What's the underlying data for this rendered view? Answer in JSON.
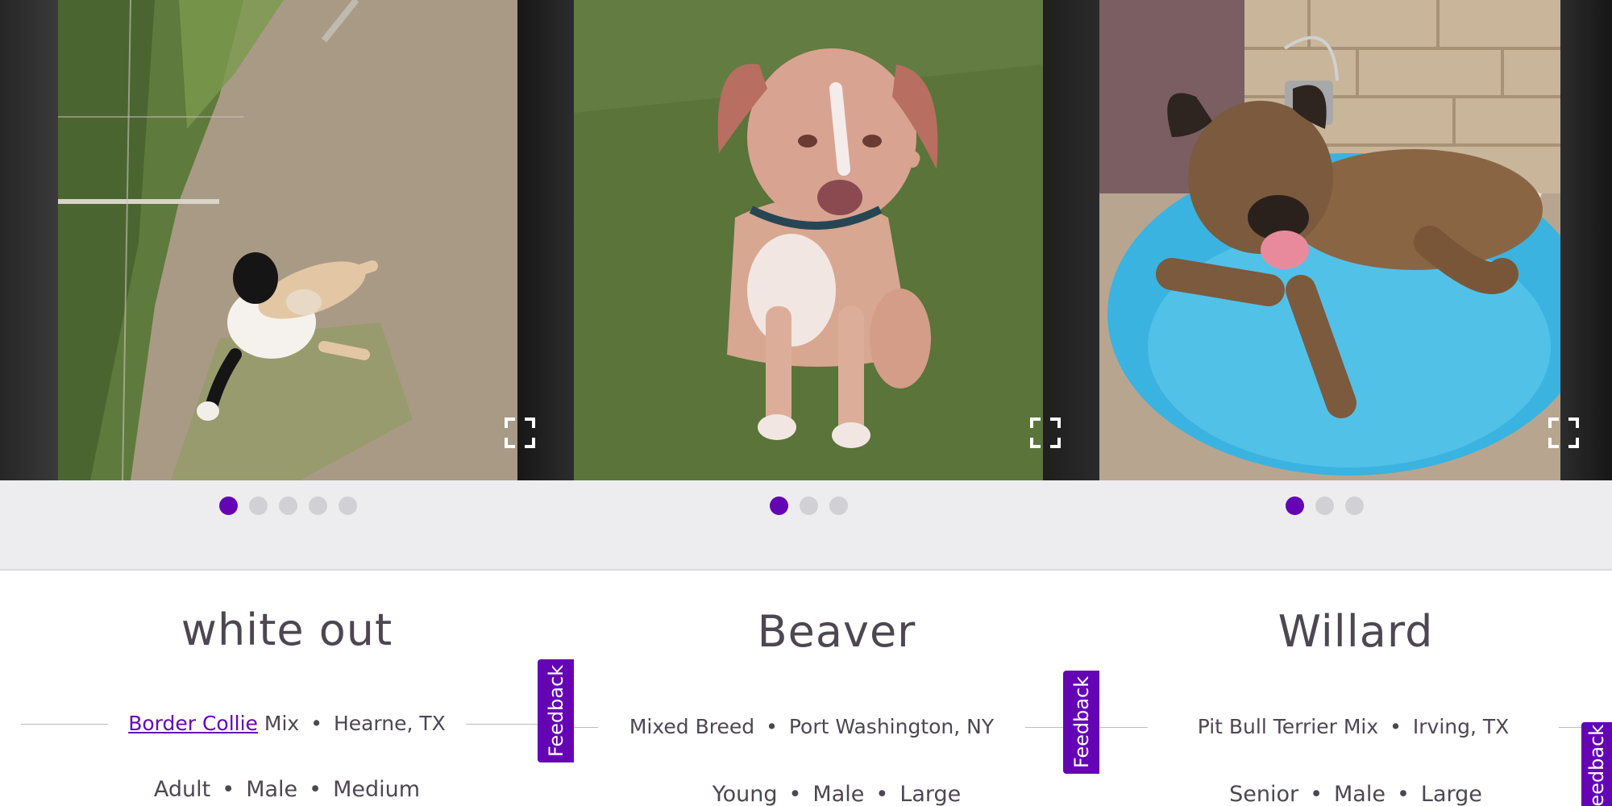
{
  "colors": {
    "accent": "#6504b5",
    "dot_inactive": "#d1d0d5",
    "text": "#4d4751",
    "dots_bar": "#ededef"
  },
  "icons": {
    "expand": "expand-fullscreen-icon"
  },
  "pets": [
    {
      "name": "white out",
      "breed_link": "Border Collie",
      "breed_suffix": "Mix",
      "location": "Hearne, TX",
      "age": "Adult",
      "gender": "Male",
      "size": "Medium",
      "photo_count": 5,
      "active_photo": 1,
      "feedback_label": "Feedback"
    },
    {
      "name": "Beaver",
      "breed": "Mixed Breed",
      "location": "Port Washington, NY",
      "age": "Young",
      "gender": "Male",
      "size": "Large",
      "photo_count": 3,
      "active_photo": 1,
      "feedback_label": "Feedback"
    },
    {
      "name": "Willard",
      "breed": "Pit Bull Terrier Mix",
      "location": "Irving, TX",
      "age": "Senior",
      "gender": "Male",
      "size": "Large",
      "photo_count": 3,
      "active_photo": 1,
      "feedback_label": "Feedback"
    }
  ],
  "separator": "•"
}
